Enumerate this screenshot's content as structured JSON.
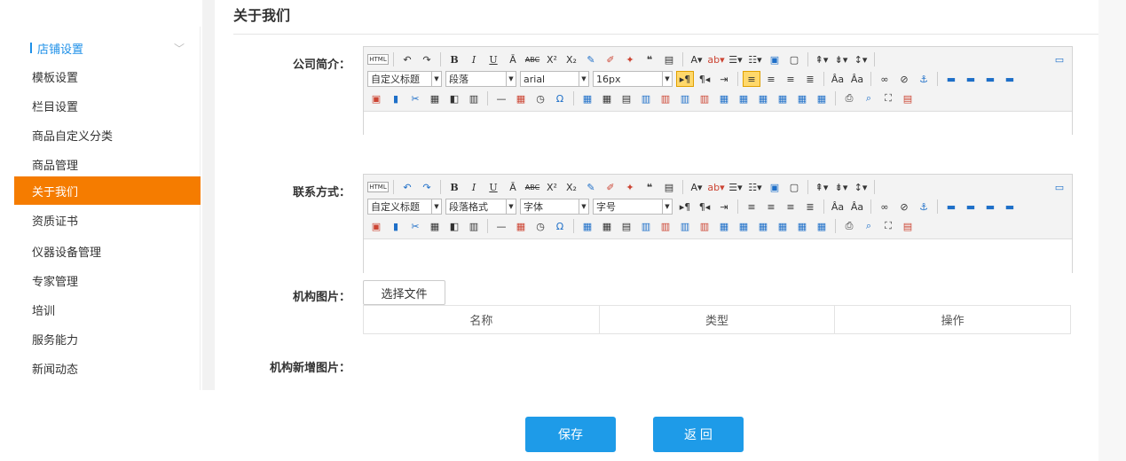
{
  "page": {
    "title": "关于我们"
  },
  "sidebar": {
    "group": "店铺设置",
    "items": [
      {
        "label": "模板设置"
      },
      {
        "label": "栏目设置"
      },
      {
        "label": "商品自定义分类"
      },
      {
        "label": "商品管理"
      },
      {
        "label": "关于我们",
        "active": true
      },
      {
        "label": "资质证书"
      },
      {
        "label": "仪器设备管理"
      },
      {
        "label": "专家管理"
      },
      {
        "label": "培训"
      },
      {
        "label": "服务能力"
      },
      {
        "label": "新闻动态"
      }
    ]
  },
  "form": {
    "company_intro_label": "公司简介：",
    "contact_label": "联系方式：",
    "org_image_label": "机构图片：",
    "org_new_image_label": "机构新增图片："
  },
  "editor1": {
    "html_btn": "HTML",
    "heading_select": "自定义标题",
    "paragraph_select": "段落",
    "font_select": "arial",
    "size_select": "16px"
  },
  "editor2": {
    "html_btn": "HTML",
    "heading_select": "自定义标题",
    "paragraph_select": "段落格式",
    "font_select": "字体",
    "size_select": "字号"
  },
  "upload": {
    "choose_file": "选择文件"
  },
  "file_table": {
    "headers": [
      "名称",
      "类型",
      "操作"
    ]
  },
  "actions": {
    "save": "保存",
    "back": "返 回"
  },
  "colors": {
    "accent": "#1e9be8",
    "active_menu": "#f57c00",
    "group_blue": "#1e90e8"
  }
}
